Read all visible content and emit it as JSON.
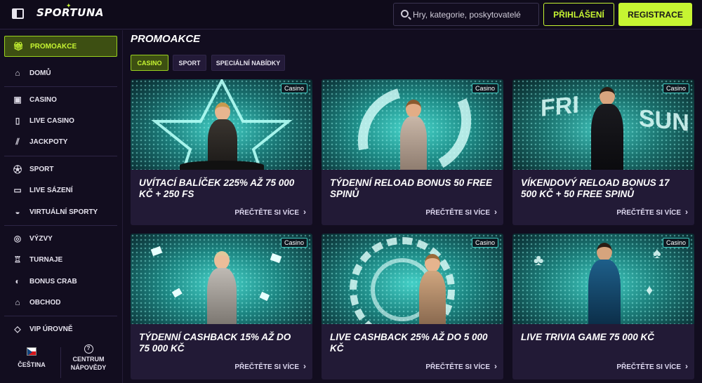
{
  "header": {
    "logo": "SPORTUNA",
    "search_placeholder": "Hry, kategorie, poskytovatelé",
    "login_label": "PŘIHLÁŠENÍ",
    "register_label": "REGISTRACE"
  },
  "sidebar": {
    "items": [
      {
        "label": "PROMOAKCE",
        "icon": "gift-icon"
      },
      {
        "label": "DOMŮ",
        "icon": "home-icon"
      },
      {
        "label": "CASINO",
        "icon": "slot-icon"
      },
      {
        "label": "LIVE CASINO",
        "icon": "live-card-icon"
      },
      {
        "label": "JACKPOTY",
        "icon": "jackpot-icon"
      },
      {
        "label": "SPORT",
        "icon": "soccer-ball-icon"
      },
      {
        "label": "LIVE SÁZENÍ",
        "icon": "live-video-icon"
      },
      {
        "label": "VIRTUÁLNÍ SPORTY",
        "icon": "gamepad-icon"
      },
      {
        "label": "VÝZVY",
        "icon": "medal-icon"
      },
      {
        "label": "TURNAJE",
        "icon": "trophy-icon"
      },
      {
        "label": "BONUS CRAB",
        "icon": "crab-icon"
      },
      {
        "label": "OBCHOD",
        "icon": "shop-icon"
      },
      {
        "label": "VIP ÚROVNĚ",
        "icon": "diamond-icon"
      }
    ],
    "language": "ČEŠTINA",
    "help_line1": "CENTRUM",
    "help_line2": "NÁPOVĚDY"
  },
  "main": {
    "title": "PROMOAKCE",
    "tabs": [
      "CASINO",
      "SPORT",
      "SPECIÁLNÍ NABÍDKY"
    ],
    "cards": [
      {
        "badge": "Casino",
        "title": "UVÍTACÍ BALÍČEK 225% AŽ 75 000 KČ + 250 FS",
        "more": "PŘEČTĚTE SI VÍCE"
      },
      {
        "badge": "Casino",
        "title": "TÝDENNÍ RELOAD BONUS 50 FREE SPINŮ",
        "more": "PŘEČTĚTE SI VÍCE"
      },
      {
        "badge": "Casino",
        "title": "VÍKENDOVÝ RELOAD BONUS 17 500 KČ + 50 FREE SPINŮ",
        "more": "PŘEČTĚTE SI VÍCE",
        "image_text": [
          "FRI",
          "SUN"
        ]
      },
      {
        "badge": "Casino",
        "title": "TÝDENNÍ CASHBACK 15% AŽ DO 75 000 KČ",
        "more": "PŘEČTĚTE SI VÍCE"
      },
      {
        "badge": "Casino",
        "title": "LIVE CASHBACK 25% AŽ DO 5 000 KČ",
        "more": "PŘEČTĚTE SI VÍCE"
      },
      {
        "badge": "Casino",
        "title": "LIVE TRIVIA GAME 75 000 KČ",
        "more": "PŘEČTĚTE SI VÍCE"
      }
    ]
  },
  "colors": {
    "accent": "#c6f432",
    "background": "#120d1f",
    "card": "#221a36",
    "teal": "#3fc7bf"
  }
}
